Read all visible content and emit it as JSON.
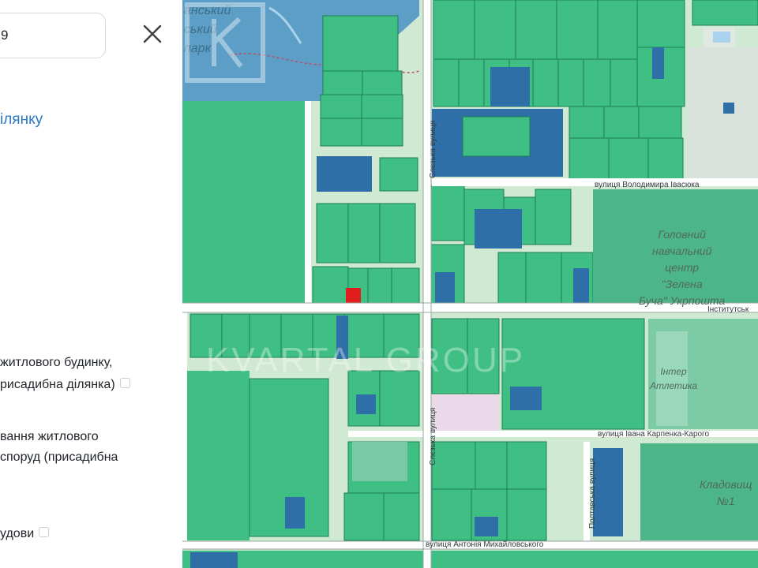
{
  "panel": {
    "search_value": "9",
    "link_text": "ілянку",
    "info": [
      "житлового будинку,",
      "рисадибна ділянка)",
      "вання житлового",
      "споруд (присадибна",
      "удови"
    ]
  },
  "map": {
    "streets": {
      "ivasiuka": "вулиця Володимира Івасюка",
      "instytutska": "Інститутськ",
      "karpenka": "вулиця Івана Карпенка-Карого",
      "mykhailovskoho": "вулиця Антонія Михайловського",
      "sleszka_top": "Слєзька вулиця",
      "sleszka_bottom": "Слєзька вулиця",
      "poltavska": "Полтавська вулиця"
    },
    "park_label_lines": [
      "анський",
      "ський",
      "парк"
    ],
    "poi": {
      "training_center": [
        "Головний",
        "навчальний",
        "центр",
        "\"Зелена",
        "Буча\" Укрпошта"
      ],
      "inter_atletika": [
        "Інтер",
        "Атлетика"
      ],
      "cemetery": [
        "Кладовищ",
        "№1"
      ]
    },
    "watermark": "KVARTAL GROUP",
    "colors": {
      "parcel_green": "#3fbf83",
      "parcel_dark": "#1a9a63",
      "parcel_blue": "#2e6fa7",
      "selected_parcel": "#e11d1d",
      "park_blue": "#5d9ec6"
    }
  }
}
